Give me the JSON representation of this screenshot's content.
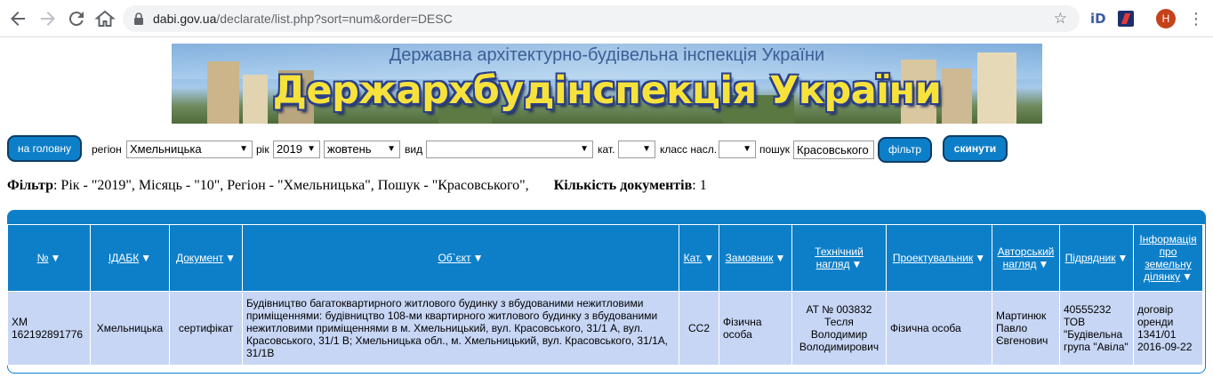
{
  "browser": {
    "url_host": "dabi.gov.ua",
    "url_path": "/declarate/list.php?sort=num&order=DESC",
    "avatar_letter": "H",
    "icons": [
      "back-icon",
      "forward-icon",
      "reload-icon",
      "home-icon",
      "lock-icon",
      "star-icon",
      "extension-icon",
      "extension-icon",
      "menu-icon"
    ]
  },
  "banner": {
    "subtitle": "Державна архітектурно-будівельна інспекція України",
    "title": "Держархбудінспекція України"
  },
  "toolbar": {
    "home_label": "на головну",
    "region_label": "регіон",
    "region_value": "Хмельницька",
    "year_label": "рік",
    "year_value": "2019",
    "month_value": "жовтень",
    "type_label": "вид",
    "type_value": "",
    "cat_label": "кат.",
    "cat_value": "",
    "class_label": "класс насл.",
    "class_value": "",
    "search_label": "пошук",
    "search_value": "Красовського",
    "filter_label": "фільтр",
    "reset_label": "скинути"
  },
  "filter_line": {
    "label": "Фільтр",
    "text": ": Рік - \"2019\", Місяць - \"10\", Регіон - \"Хмельницька\", Пошук - \"Красовського\",",
    "count_label": "Кількість документів",
    "count_value": ": 1"
  },
  "table": {
    "headers": [
      "№",
      "ІДАБК",
      "Документ",
      "Об`єкт",
      "Кат.",
      "Замовник",
      "Технічний нагляд",
      "Проектувальник",
      "Авторський нагляд",
      "Підрядник",
      "Інформація про земельну ділянку"
    ],
    "rows": [
      [
        "ХМ 162192891776",
        "Хмельницька",
        "сертифікат",
        "Будівництво багатоквартирного житлового будинку з вбудованими нежитловими приміщеннями: будівництво 108-ми квартирного житлового будинку з вбудованими нежитловими приміщеннями в м. Хмельницький, вул. Красовського, 31/1 А, вул. Красовського, 31/1 В; Хмельницька обл., м. Хмельницький, вул. Красовського, 31/1А, 31/1В",
        "СС2",
        "Фізична особа",
        "АТ № 003832 Тесля Володимир Володимирович",
        "Фізична особа",
        "Мартинюк Павло Євгенович",
        "40555232 ТОВ \"Будівельна група \"Авіла\"",
        "договір оренди 1341/01 2016-09-22"
      ]
    ]
  }
}
